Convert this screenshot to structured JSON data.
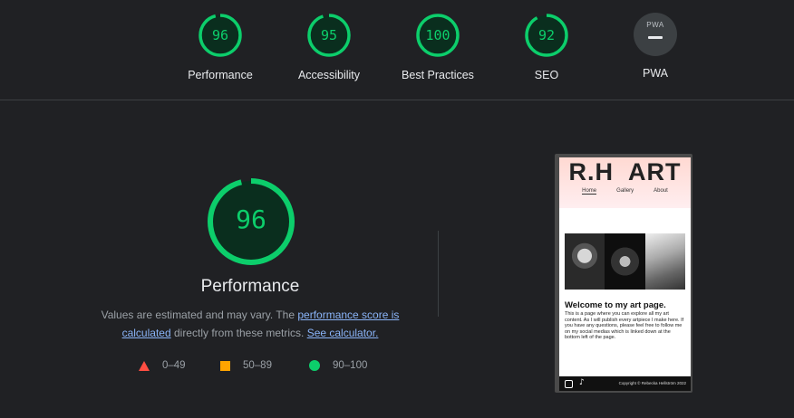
{
  "categories": [
    {
      "label": "Performance",
      "score": "96",
      "color": "#0cce6b",
      "fraction": 0.96
    },
    {
      "label": "Accessibility",
      "score": "95",
      "color": "#0cce6b",
      "fraction": 0.95
    },
    {
      "label": "Best Practices",
      "score": "100",
      "color": "#0cce6b",
      "fraction": 1.0
    },
    {
      "label": "SEO",
      "score": "92",
      "color": "#0cce6b",
      "fraction": 0.92
    },
    {
      "label": "PWA",
      "badge": "PWA"
    }
  ],
  "main": {
    "score": "96",
    "fraction": 0.96,
    "title": "Performance",
    "desc_prefix": "Values are estimated and may vary. The ",
    "desc_link1": "performance score is calculated",
    "desc_middle": " directly from these metrics. ",
    "desc_link2": "See calculator."
  },
  "legend": [
    {
      "range": "0–49",
      "color": "#ff4e42"
    },
    {
      "range": "50–89",
      "color": "#ffa400"
    },
    {
      "range": "90–100",
      "color": "#0cce6b"
    }
  ],
  "screenshot": {
    "site_title": "R.H  ART",
    "nav": [
      "Home",
      "Gallery",
      "About"
    ],
    "heading": "Welcome to my art page.",
    "paragraph": "This is a page where you can explore all my art content. As I will publish every artpiece I make here. If you have any questions, please feel free to follow me on my social medias which is linked down at the bottom left of the page.",
    "tiktok_glyph": "♪",
    "copyright": "Copyright © Rebecka Hellström 2022"
  }
}
